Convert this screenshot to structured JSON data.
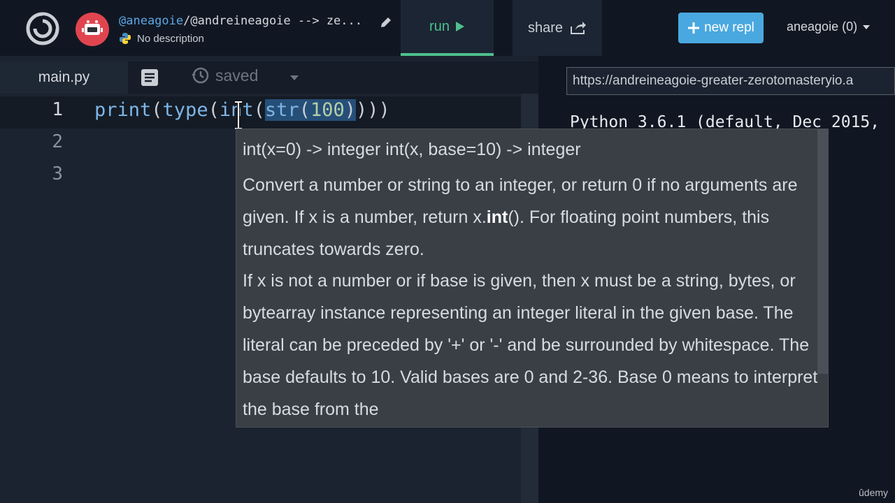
{
  "header": {
    "repl_owner": "@aneagoie",
    "repl_path_rest": "/@andreineagoie --> ze...",
    "description": "No description",
    "run_label": "run",
    "share_label": "share",
    "new_repl_label": "new repl",
    "user_menu_label": "aneagoie (0)"
  },
  "editor": {
    "tab_label": "main.py",
    "saved_label": "saved",
    "line_numbers": [
      "1",
      "2",
      "3"
    ],
    "code": {
      "t1": "print",
      "t2": "(",
      "t3": "type",
      "t4": "(",
      "t5": "int",
      "t6": "(",
      "t7": "str",
      "t8": "(",
      "t9": "100",
      "t10": ")",
      "t11": ")))"
    }
  },
  "tooltip": {
    "signature": "int(x=0) -> integer int(x, base=10) -> integer",
    "body_a": "Convert a number or string to an integer, or return 0 if no arguments are given. If x is a number, return x.",
    "body_bold": "int",
    "body_b": "(). For floating point numbers, this truncates towards zero.",
    "body_c": "If x is not a number or if base is given, then x must be a string, bytes, or bytearray instance representing an integer literal in the given base. The literal can be preceded by '+' or '-' and be surrounded by whitespace. The base defaults to 10. Valid bases are 0 and 2-36. Base 0 means to interpret the base from the"
  },
  "console": {
    "url": "https://andreineagoie-greater-zerotomasteryio.a",
    "output": "Python 3.6.1 (default, Dec 2015,"
  },
  "watermark": "ûdemy",
  "colors": {
    "accent_green": "#4fc08d",
    "new_repl_blue": "#4aa8e0",
    "avatar_red": "#e0454f",
    "selection": "#264f78"
  },
  "icons": {
    "logo": "replit-swirl-logo",
    "avatar": "robot-avatar",
    "edit": "pencil-icon",
    "language": "python-icon",
    "run": "play-icon",
    "share": "share-arrow-icon",
    "new": "plus-icon",
    "user_menu": "caret-down-icon",
    "doc": "document-icon",
    "saved": "history-clock-icon",
    "saved_menu": "caret-down-icon"
  }
}
